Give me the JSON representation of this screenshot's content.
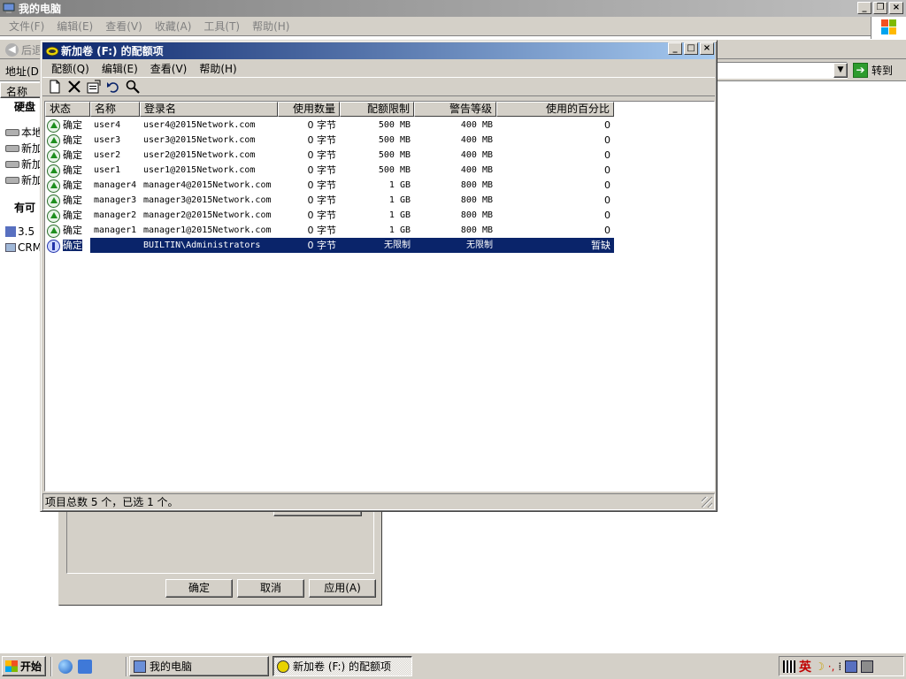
{
  "explorer": {
    "title": "我的电脑",
    "menu": [
      "文件(F)",
      "编辑(E)",
      "查看(V)",
      "收藏(A)",
      "工具(T)",
      "帮助(H)"
    ],
    "back_label": "后退",
    "address_label": "地址(D)",
    "goto_label": "转到",
    "column_name": "名称",
    "section_disks": "硬盘",
    "left_items": [
      "本地",
      "新加",
      "新加",
      "新加"
    ],
    "section_removable": "有可",
    "left_items2": [
      "3.5",
      "CRM"
    ]
  },
  "bg_dialog": {
    "ok": "确定",
    "cancel": "取消",
    "apply": "应用(A)"
  },
  "quota": {
    "title": "新加卷 (F:) 的配额项",
    "menu": [
      "配额(Q)",
      "编辑(E)",
      "查看(V)",
      "帮助(H)"
    ],
    "toolbar_icons": [
      "new-entry-icon",
      "delete-icon",
      "properties-icon",
      "undo-icon",
      "find-icon"
    ],
    "columns": [
      "状态",
      "名称",
      "登录名",
      "使用数量",
      "配额限制",
      "警告等级",
      "使用的百分比"
    ],
    "rows": [
      {
        "status": "确定",
        "name": "user4",
        "login": "user4@2015Network.com",
        "used": "0 字节",
        "limit": "500 MB",
        "warn": "400 MB",
        "pct": "0"
      },
      {
        "status": "确定",
        "name": "user3",
        "login": "user3@2015Network.com",
        "used": "0 字节",
        "limit": "500 MB",
        "warn": "400 MB",
        "pct": "0"
      },
      {
        "status": "确定",
        "name": "user2",
        "login": "user2@2015Network.com",
        "used": "0 字节",
        "limit": "500 MB",
        "warn": "400 MB",
        "pct": "0"
      },
      {
        "status": "确定",
        "name": "user1",
        "login": "user1@2015Network.com",
        "used": "0 字节",
        "limit": "500 MB",
        "warn": "400 MB",
        "pct": "0"
      },
      {
        "status": "确定",
        "name": "manager4",
        "login": "manager4@2015Network.com",
        "used": "0 字节",
        "limit": "1 GB",
        "warn": "800 MB",
        "pct": "0"
      },
      {
        "status": "确定",
        "name": "manager3",
        "login": "manager3@2015Network.com",
        "used": "0 字节",
        "limit": "1 GB",
        "warn": "800 MB",
        "pct": "0"
      },
      {
        "status": "确定",
        "name": "manager2",
        "login": "manager2@2015Network.com",
        "used": "0 字节",
        "limit": "1 GB",
        "warn": "800 MB",
        "pct": "0"
      },
      {
        "status": "确定",
        "name": "manager1",
        "login": "manager1@2015Network.com",
        "used": "0 字节",
        "limit": "1 GB",
        "warn": "800 MB",
        "pct": "0"
      },
      {
        "status": "确定",
        "name": "",
        "login": "BUILTIN\\Administrators",
        "used": "0 字节",
        "limit": "无限制",
        "warn": "无限制",
        "pct": "暂缺"
      }
    ],
    "status_text": "项目总数 5 个，已选 1 个。"
  },
  "taskbar": {
    "start": "开始",
    "task1": "我的电脑",
    "task2": "新加卷 (F:) 的配额项",
    "ime_lang": "英"
  }
}
